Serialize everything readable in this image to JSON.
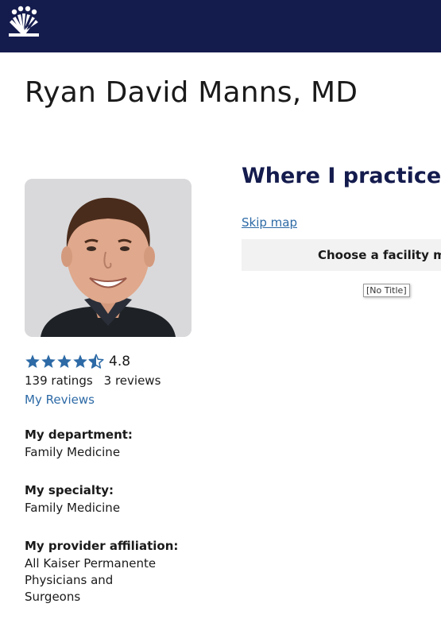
{
  "header": {
    "logo_icon": "kaiser-permanente-logo-icon"
  },
  "provider": {
    "name": "Ryan David Manns, MD",
    "rating_value": "4.8",
    "stars": 4.5,
    "ratings_count": "139 ratings",
    "reviews_count": "3 reviews",
    "reviews_link": "My Reviews",
    "department_label": "My department:",
    "department": "Family Medicine",
    "specialty_label": "My specialty:",
    "specialty": "Family Medicine",
    "affiliation_label": "My provider affiliation:",
    "affiliation": "All Kaiser Permanente Physicians and Surgeons"
  },
  "practice": {
    "title": "Where I practice",
    "skip_map": "Skip map",
    "facility_prompt": "Choose a facility ma",
    "tooltip": "[No Title]"
  },
  "colors": {
    "header_bg": "#141b4d",
    "star": "#2d6aa6",
    "link": "#2d6aa6"
  }
}
